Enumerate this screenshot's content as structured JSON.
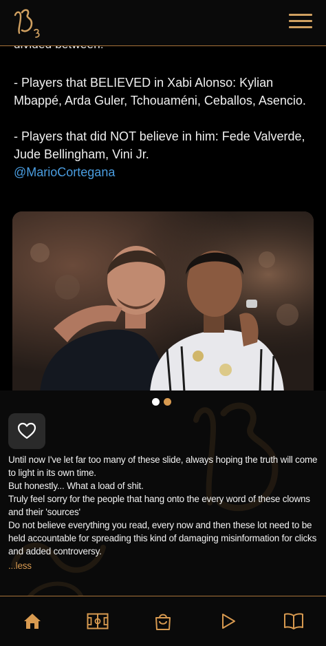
{
  "header": {
    "logo_icon": "brand-monogram-logo",
    "menu_icon": "hamburger-menu-icon",
    "accent": "#d0a060"
  },
  "post": {
    "cut_text": "divided between:",
    "lines": [
      "- Players that BELIEVED in Xabi Alonso: Kylian Mbappé, Arda Guler, Tchouaméni, Ceballos, Asencio.",
      "- Players that did NOT believe in him: Fede Valverde, Jude Bellingham, Vini Jr."
    ],
    "mention": "@MarioCortegana",
    "mention_color": "#4a9de0"
  },
  "carousel": {
    "slides": 2,
    "active_index": 0
  },
  "like": {
    "icon": "heart-icon"
  },
  "caption": {
    "lines": [
      "Until now I've let far too many of these slide, always hoping the truth will come to light in its own time.",
      "But honestly... What a load of shit.",
      "Truly feel sorry for the people that hang onto the every word of these clowns and their 'sources'",
      "Do not believe everything you read, every now and then these lot need to be held accountable for spreading this kind of damaging misinformation for clicks and added controversy."
    ],
    "less_label": "...less"
  },
  "nav": {
    "items": [
      "home-icon",
      "pitch-icon",
      "shop-bag-icon",
      "play-icon",
      "book-icon"
    ],
    "active": "home-icon",
    "accent": "#d89a50"
  }
}
